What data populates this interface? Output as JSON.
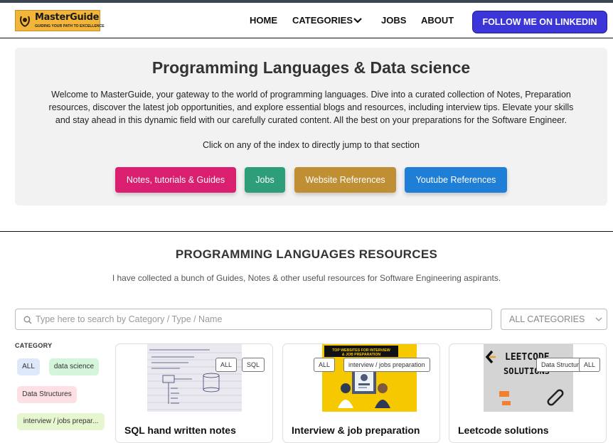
{
  "brand": {
    "name": "MasterGuide",
    "tagline": "GUIDING YOUR PATH TO EXCELLENCE",
    "color": "#f2b53a"
  },
  "nav": {
    "home": "HOME",
    "categories": "CATEGORIES",
    "jobs": "JOBS",
    "about": "ABOUT",
    "follow": "FOLLOW ME ON LINKEDIN",
    "follow_color": "#3c36d9"
  },
  "hero": {
    "title": "Programming Languages & Data science",
    "desc_lines": [
      "Welcome to MasterGuide, your gateway to the world of programming languages. Dive into a curated collection of Notes, Preparation",
      "resources, discover the latest job opportunities, and explore essential blogs and resources, including interview tips. Elevate your skills",
      "and stay ahead in this dynamic field with our carefully curated content. All the best on your preparations for the Software Engineer."
    ],
    "hint": "Click on any of the index to directly jump to that section",
    "buttons": [
      {
        "label": "Notes, tutorials & Guides",
        "color": "#db1f70"
      },
      {
        "label": "Jobs",
        "color": "#2e9e7a"
      },
      {
        "label": "Website References",
        "color": "#c08f33"
      },
      {
        "label": "Youtube References",
        "color": "#1f7fd6"
      }
    ]
  },
  "resources": {
    "title": "PROGRAMMING LANGUAGES RESOURCES",
    "subtitle": "I have collected a bunch of Guides, Notes & other useful resources for Software Engineering aspirants.",
    "search_placeholder": "Type here to search by Category / Type / Name",
    "select_value": "ALL CATEGORIES",
    "category_label": "CATEGORY",
    "chips": [
      {
        "label": "ALL",
        "color": "#dde8fb"
      },
      {
        "label": "data science",
        "color": "#d4f5dc"
      },
      {
        "label": "Data Structures",
        "color": "#fde0e3"
      },
      {
        "label": "interview / jobs prepar...",
        "color": "#e6f7cf"
      }
    ],
    "cards": [
      {
        "title": "SQL hand written notes",
        "tags": [
          "ALL",
          "SQL"
        ],
        "thumb_title": "SQL ( Structured Query Language)"
      },
      {
        "title": "Interview & job preparation",
        "tags": [
          "ALL",
          "interview / jobs preparation"
        ],
        "thumb_title": "TOP WEBSITES FOR INTERVIEW & JOB PREPARATION"
      },
      {
        "title": "Leetcode solutions",
        "tags": [
          "Data Structures",
          "ALL"
        ],
        "thumb_title": "LEETCODE SOLUTIONS"
      }
    ]
  }
}
